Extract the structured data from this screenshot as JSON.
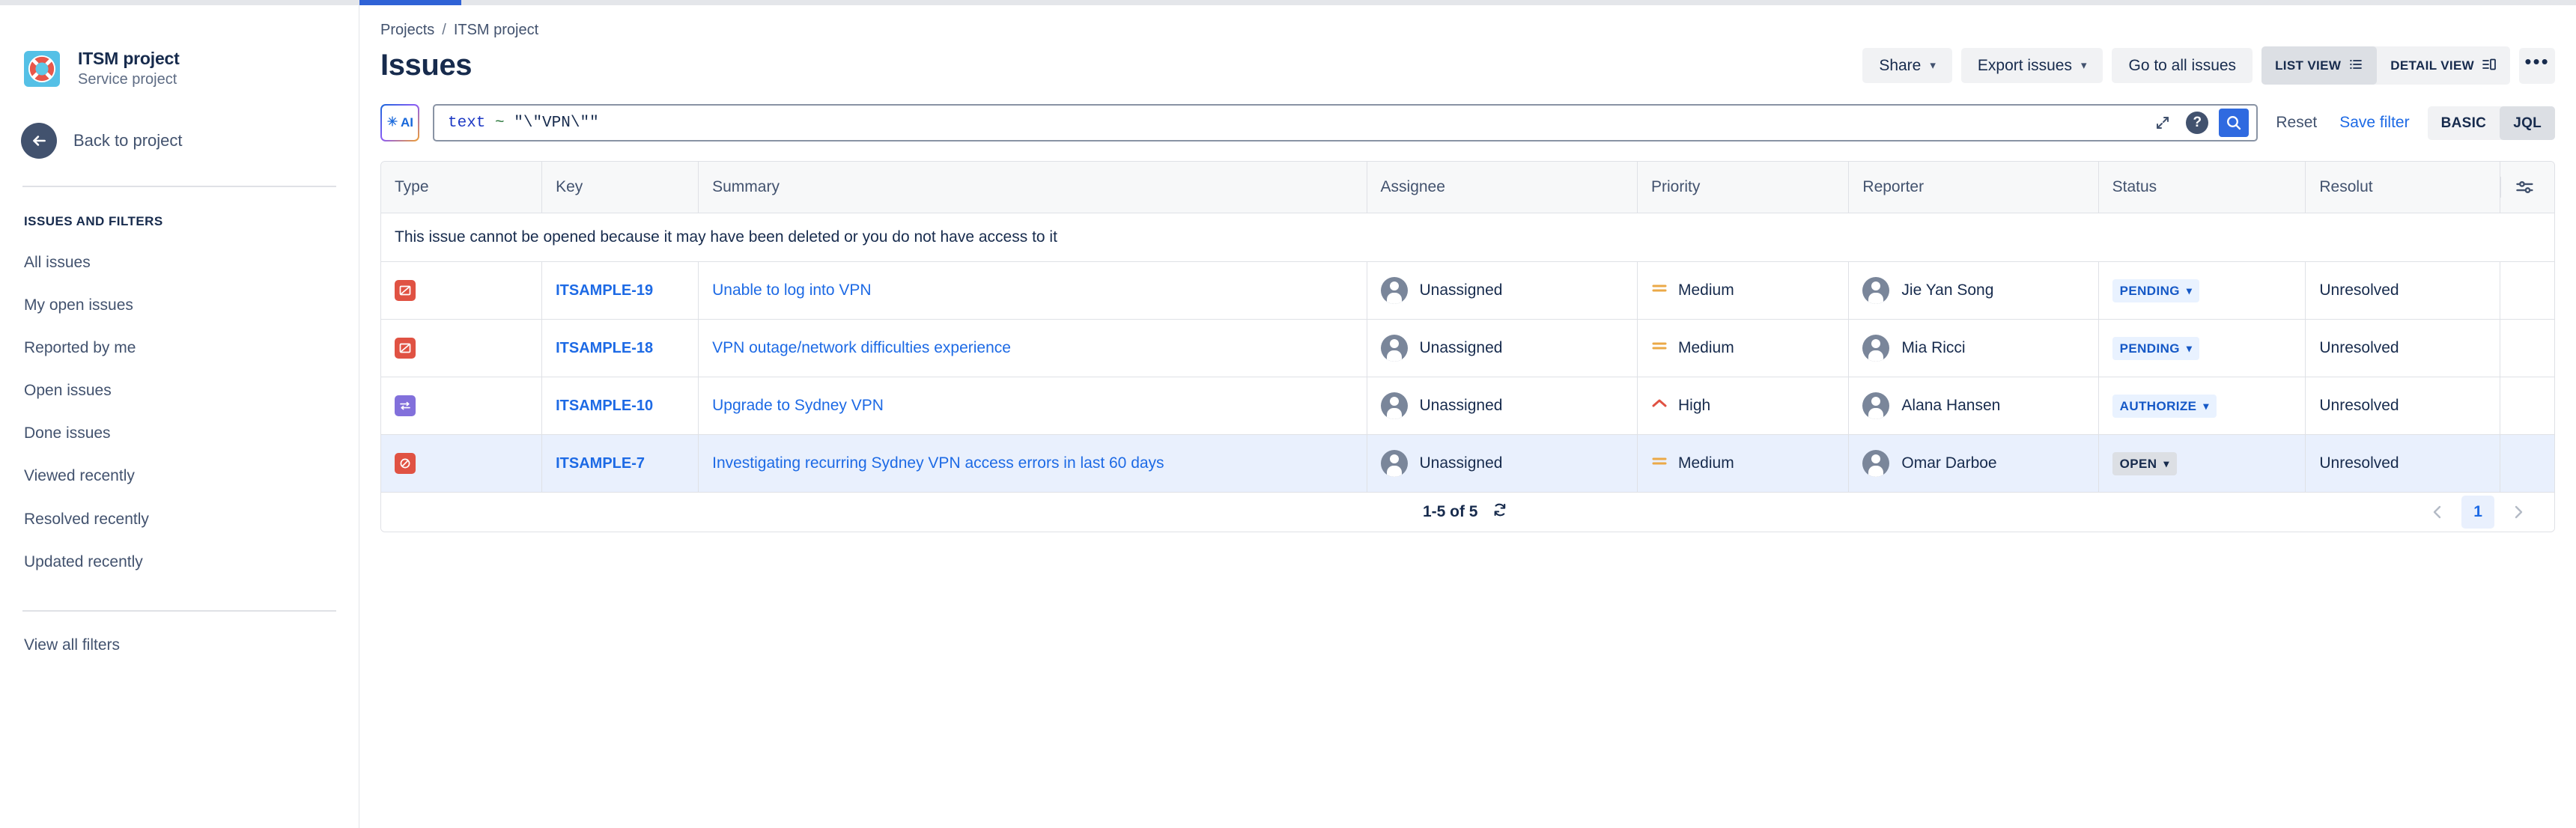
{
  "window": {
    "tab_indicator_color": "#2f62d6"
  },
  "sidebar": {
    "project": {
      "name": "ITSM project",
      "type": "Service project",
      "avatar_icon": "lifebuoy-icon"
    },
    "back_label": "Back to project",
    "section_title": "ISSUES AND FILTERS",
    "items": [
      {
        "label": "All issues"
      },
      {
        "label": "My open issues"
      },
      {
        "label": "Reported by me"
      },
      {
        "label": "Open issues"
      },
      {
        "label": "Done issues"
      },
      {
        "label": "Viewed recently"
      },
      {
        "label": "Resolved recently"
      },
      {
        "label": "Updated recently"
      }
    ],
    "view_all_filters": "View all filters"
  },
  "header": {
    "breadcrumb": {
      "projects": "Projects",
      "separator": "/",
      "current": "ITSM project"
    },
    "title": "Issues",
    "actions": {
      "share": "Share",
      "export": "Export issues",
      "go_to_all": "Go to all issues",
      "list_view": "LIST VIEW",
      "detail_view": "DETAIL VIEW",
      "more": "•••"
    }
  },
  "search": {
    "ai_label": "AI",
    "jql_prefix": "text",
    "jql_operator": "~",
    "jql_value": "\"\\\"VPN\\\"\"",
    "jql_full": "text ~ \"\\\"VPN\\\"\"",
    "reset": "Reset",
    "save_filter": "Save filter",
    "mode_basic": "BASIC",
    "mode_jql": "JQL",
    "expand_icon": "expand-icon",
    "help_icon": "help-icon",
    "search_icon": "search-icon"
  },
  "table": {
    "columns": [
      "Type",
      "Key",
      "Summary",
      "Assignee",
      "Priority",
      "Reporter",
      "Status",
      "Resolut"
    ],
    "config_icon": "column-settings-icon",
    "notice": "This issue cannot be opened because it may have been deleted or you do not have access to it",
    "rows": [
      {
        "type_icon": "it-help-icon",
        "type_color": "#e05243",
        "key": "ITSAMPLE-19",
        "summary": "Unable to log into VPN",
        "assignee": "Unassigned",
        "priority": "Medium",
        "priority_icon": "priority-medium-icon",
        "priority_color": "#eba947",
        "reporter": "Jie Yan Song",
        "status": "PENDING",
        "status_style": "blue",
        "resolution": "Unresolved",
        "highlighted": false
      },
      {
        "type_icon": "it-help-icon",
        "type_color": "#e05243",
        "key": "ITSAMPLE-18",
        "summary": "VPN outage/network difficulties experience",
        "assignee": "Unassigned",
        "priority": "Medium",
        "priority_icon": "priority-medium-icon",
        "priority_color": "#eba947",
        "reporter": "Mia Ricci",
        "status": "PENDING",
        "status_style": "blue",
        "resolution": "Unresolved",
        "highlighted": false
      },
      {
        "type_icon": "change-request-icon",
        "type_color": "#8270db",
        "key": "ITSAMPLE-10",
        "summary": "Upgrade to Sydney VPN",
        "assignee": "Unassigned",
        "priority": "High",
        "priority_icon": "priority-high-icon",
        "priority_color": "#e05243",
        "reporter": "Alana Hansen",
        "status": "AUTHORIZE",
        "status_style": "blue",
        "resolution": "Unresolved",
        "highlighted": false
      },
      {
        "type_icon": "problem-icon",
        "type_color": "#e05243",
        "key": "ITSAMPLE-7",
        "summary": "Investigating recurring Sydney VPN access errors in last 60 days",
        "assignee": "Unassigned",
        "priority": "Medium",
        "priority_icon": "priority-medium-icon",
        "priority_color": "#eba947",
        "reporter": "Omar Darboe",
        "status": "OPEN",
        "status_style": "grey",
        "resolution": "Unresolved",
        "highlighted": true
      }
    ],
    "footer": {
      "count": "1-5 of 5",
      "refresh_icon": "refresh-icon",
      "prev_icon": "chevron-left-icon",
      "next_icon": "chevron-right-icon",
      "current_page": "1"
    }
  }
}
